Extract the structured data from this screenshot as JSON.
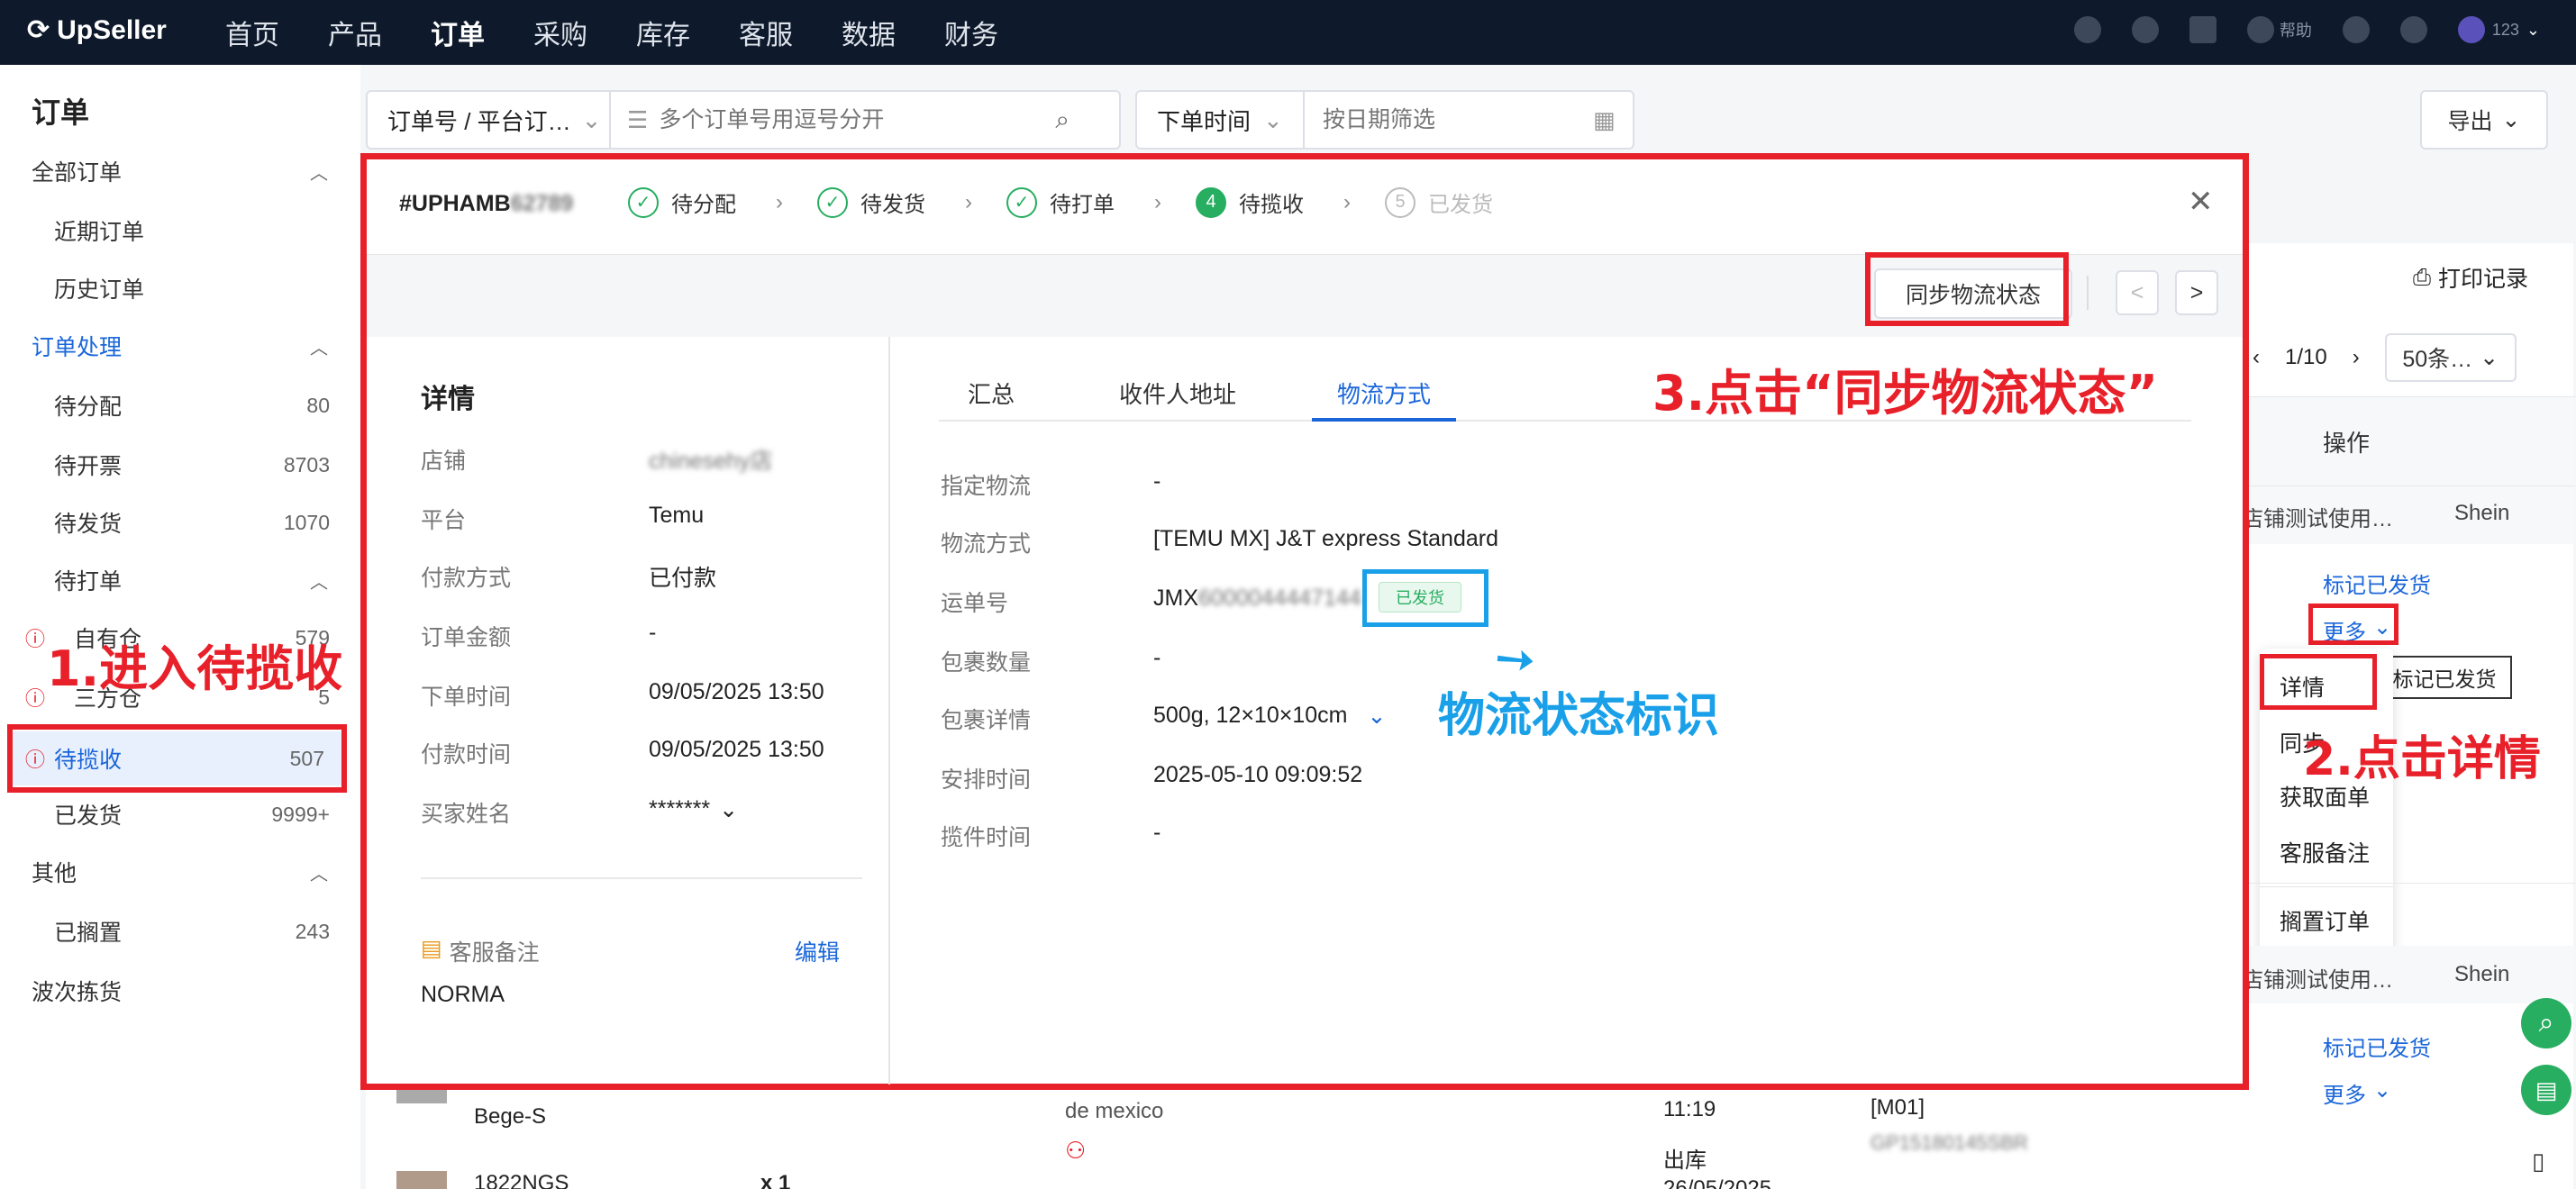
{
  "app": {
    "name": "UpSeller"
  },
  "topnav": {
    "items": [
      "首页",
      "产品",
      "订单",
      "采购",
      "库存",
      "客服",
      "数据",
      "财务"
    ],
    "active": "订单",
    "right_text": [
      "帮助",
      "123"
    ]
  },
  "sidebar": {
    "title": "订单",
    "groups": [
      {
        "label": "全部订单",
        "children": [
          {
            "label": "近期订单"
          },
          {
            "label": "历史订单"
          }
        ]
      },
      {
        "label": "订单处理",
        "children": [
          {
            "label": "待分配",
            "count": "80"
          },
          {
            "label": "待开票",
            "count": "8703"
          },
          {
            "label": "待发货",
            "count": "1070"
          },
          {
            "label": "待打单",
            "children": [
              {
                "label": "自有仓",
                "count": "579"
              },
              {
                "label": "三方仓",
                "count": "5"
              }
            ]
          },
          {
            "label": "待揽收",
            "count": "507"
          },
          {
            "label": "已发货",
            "count": "9999+"
          }
        ]
      },
      {
        "label": "其他",
        "children": [
          {
            "label": "已搁置",
            "count": "243"
          }
        ]
      },
      {
        "label": "波次拣货"
      }
    ]
  },
  "filters": {
    "order_type": "订单号 / 平台订…",
    "order_placeholder": "多个订单号用逗号分开",
    "date_type": "下单时间",
    "date_placeholder": "按日期筛选",
    "export": "导出"
  },
  "list": {
    "print": "打印记录",
    "pager": "1/10",
    "page_size": "50条…",
    "op_header": "操作",
    "store_trunc": "店铺测试使用…",
    "platform": "Shein",
    "mark_shipped": "标记已发货",
    "more": "更多",
    "tooltip": "标记已发货",
    "menu": [
      "详情",
      "同步",
      "获取面单",
      "客服备注",
      "搁置订单"
    ],
    "row2": {
      "store": "店铺测试使用…",
      "platform": "Shein",
      "mark": "标记已发货",
      "more": "更多"
    },
    "bg_rows": [
      {
        "sku": "Bege-S",
        "addr": "de mexico",
        "time": "11:19",
        "wh": "出库",
        "date": "26/05/2025",
        "tag": "[M01]",
        "tracking": "GP15180145SBR"
      },
      {
        "sku": "1822NGS",
        "qty": "x 1"
      }
    ]
  },
  "modal": {
    "order_id_prefix": "#UPHAMB",
    "order_id_blur": "62789",
    "steps": [
      {
        "label": "待分配",
        "state": "done"
      },
      {
        "label": "待发货",
        "state": "done"
      },
      {
        "label": "待打单",
        "state": "done"
      },
      {
        "num": "4",
        "label": "待揽收",
        "state": "current"
      },
      {
        "num": "5",
        "label": "已发货",
        "state": "todo"
      }
    ],
    "sync_button": "同步物流状态",
    "prev": "<",
    "next": ">",
    "details": {
      "title": "详情",
      "rows": [
        {
          "label": "店铺",
          "value": "chinesehy店",
          "blur": true
        },
        {
          "label": "平台",
          "value": "Temu"
        },
        {
          "label": "付款方式",
          "value": "已付款"
        },
        {
          "label": "订单金额",
          "value": "-"
        },
        {
          "label": "下单时间",
          "value": "09/05/2025 13:50"
        },
        {
          "label": "付款时间",
          "value": "09/05/2025 13:50"
        },
        {
          "label": "买家姓名",
          "value": "*******"
        }
      ],
      "note_label": "客服备注",
      "note_edit": "编辑",
      "note_value": "NORMA"
    },
    "tabs": [
      "汇总",
      "收件人地址",
      "物流方式"
    ],
    "active_tab": "物流方式",
    "logistics": [
      {
        "label": "指定物流",
        "value": "-"
      },
      {
        "label": "物流方式",
        "value": "[TEMU MX] J&T express Standard"
      },
      {
        "label": "运单号",
        "value": "JMX",
        "value_blur": "6000044447144",
        "badge": "已发货"
      },
      {
        "label": "包裹数量",
        "value": "-"
      },
      {
        "label": "包裹详情",
        "value": "500g, 12×10×10cm"
      },
      {
        "label": "安排时间",
        "value": "2025-05-10 09:09:52"
      },
      {
        "label": "揽件时间",
        "value": "-"
      }
    ]
  },
  "annotations": {
    "step1": "1.进入待揽收",
    "step2": "2.点击详情",
    "step3": "3.点击“同步物流状态”",
    "status_tag": "物流状态标识"
  },
  "colors": {
    "topbar": "#0e1a2b",
    "accent": "#1a66d9",
    "annotation_red": "#e8202a",
    "annotation_blue": "#1aa0e8",
    "success": "#27ae60"
  }
}
